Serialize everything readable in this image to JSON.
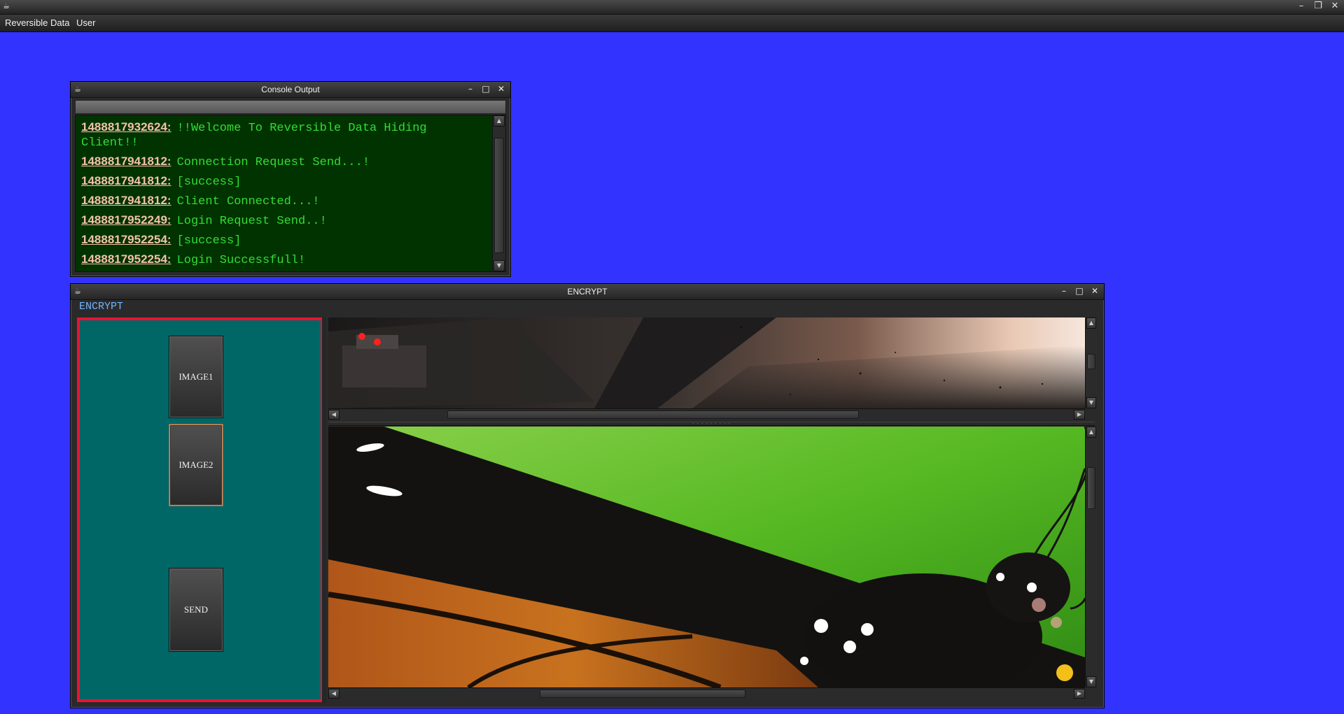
{
  "main_window": {
    "app_icon": "java-cup-icon",
    "controls": [
      "minimize",
      "maximize",
      "close"
    ],
    "menu": [
      "Reversible Data",
      "User"
    ]
  },
  "console": {
    "title": "Console Output",
    "lines": [
      {
        "ts": "1488817932624:",
        "msg": "!!Welcome To Reversible Data Hiding Client!!"
      },
      {
        "ts": "1488817941812:",
        "msg": "Connection Request Send...!"
      },
      {
        "ts": "1488817941812:",
        "msg": "[success]"
      },
      {
        "ts": "1488817941812:",
        "msg": "Client Connected...!"
      },
      {
        "ts": "1488817952249:",
        "msg": "Login Request Send..!"
      },
      {
        "ts": "1488817952254:",
        "msg": "[success]"
      },
      {
        "ts": "1488817952254:",
        "msg": "Login Successfull!"
      }
    ]
  },
  "encrypt": {
    "title": "ENCRYPT",
    "panel_label": "ENCRYPT",
    "buttons": {
      "image1": "IMAGE1",
      "image2": "IMAGE2",
      "send": "SEND"
    }
  },
  "colors": {
    "desktop": "#3333ff",
    "console_bg": "#003300",
    "console_text": "#33dd33",
    "timestamp": "#f4c2a8",
    "panel_bg": "#006666",
    "panel_border": "#ee1133"
  }
}
